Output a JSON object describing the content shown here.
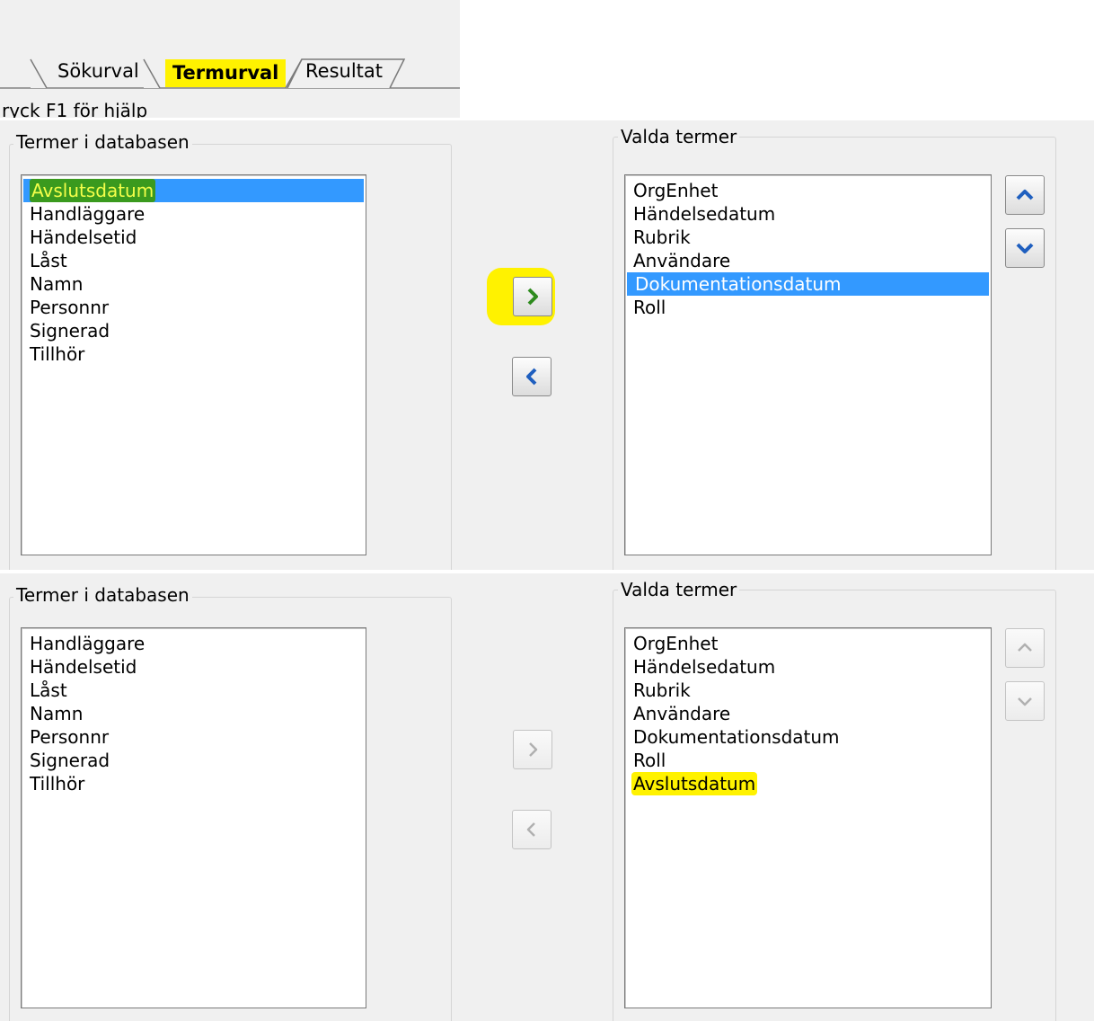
{
  "tabs": {
    "sokurval": "Sökurval",
    "termurval": "Termurval",
    "resultat": "Resultat"
  },
  "status": {
    "help_text": "ryck F1 för hjälp"
  },
  "before": {
    "left_title": "Termer i databasen",
    "right_title": "Valda termer",
    "left_items": [
      "Avslutsdatum",
      "Handläggare",
      "Händelsetid",
      "Låst",
      "Namn",
      "Personnr",
      "Signerad",
      "Tillhör"
    ],
    "right_items": [
      "OrgEnhet",
      "Händelsedatum",
      "Rubrik",
      "Användare",
      "Dokumentationsdatum",
      "Roll"
    ],
    "left_selected": "Avslutsdatum",
    "right_selected": "Dokumentationsdatum"
  },
  "after": {
    "left_title": "Termer i databasen",
    "right_title": "Valda termer",
    "left_items": [
      "Handläggare",
      "Händelsetid",
      "Låst",
      "Namn",
      "Personnr",
      "Signerad",
      "Tillhör"
    ],
    "right_items": [
      "OrgEnhet",
      "Händelsedatum",
      "Rubrik",
      "Användare",
      "Dokumentationsdatum",
      "Roll",
      "Avslutsdatum"
    ],
    "right_highlighted": "Avslutsdatum"
  },
  "icons": {
    "add": "chevron-right-icon",
    "remove": "chevron-left-icon",
    "up": "chevron-up-icon",
    "down": "chevron-down-icon"
  },
  "colors": {
    "selection": "#3399ff",
    "highlight_yellow": "#fff200",
    "highlight_green": "#3a9a1e",
    "chevron_blue": "#1f5fbf",
    "chevron_green": "#2e8b1e",
    "disabled_gray": "#b0b0b0"
  }
}
